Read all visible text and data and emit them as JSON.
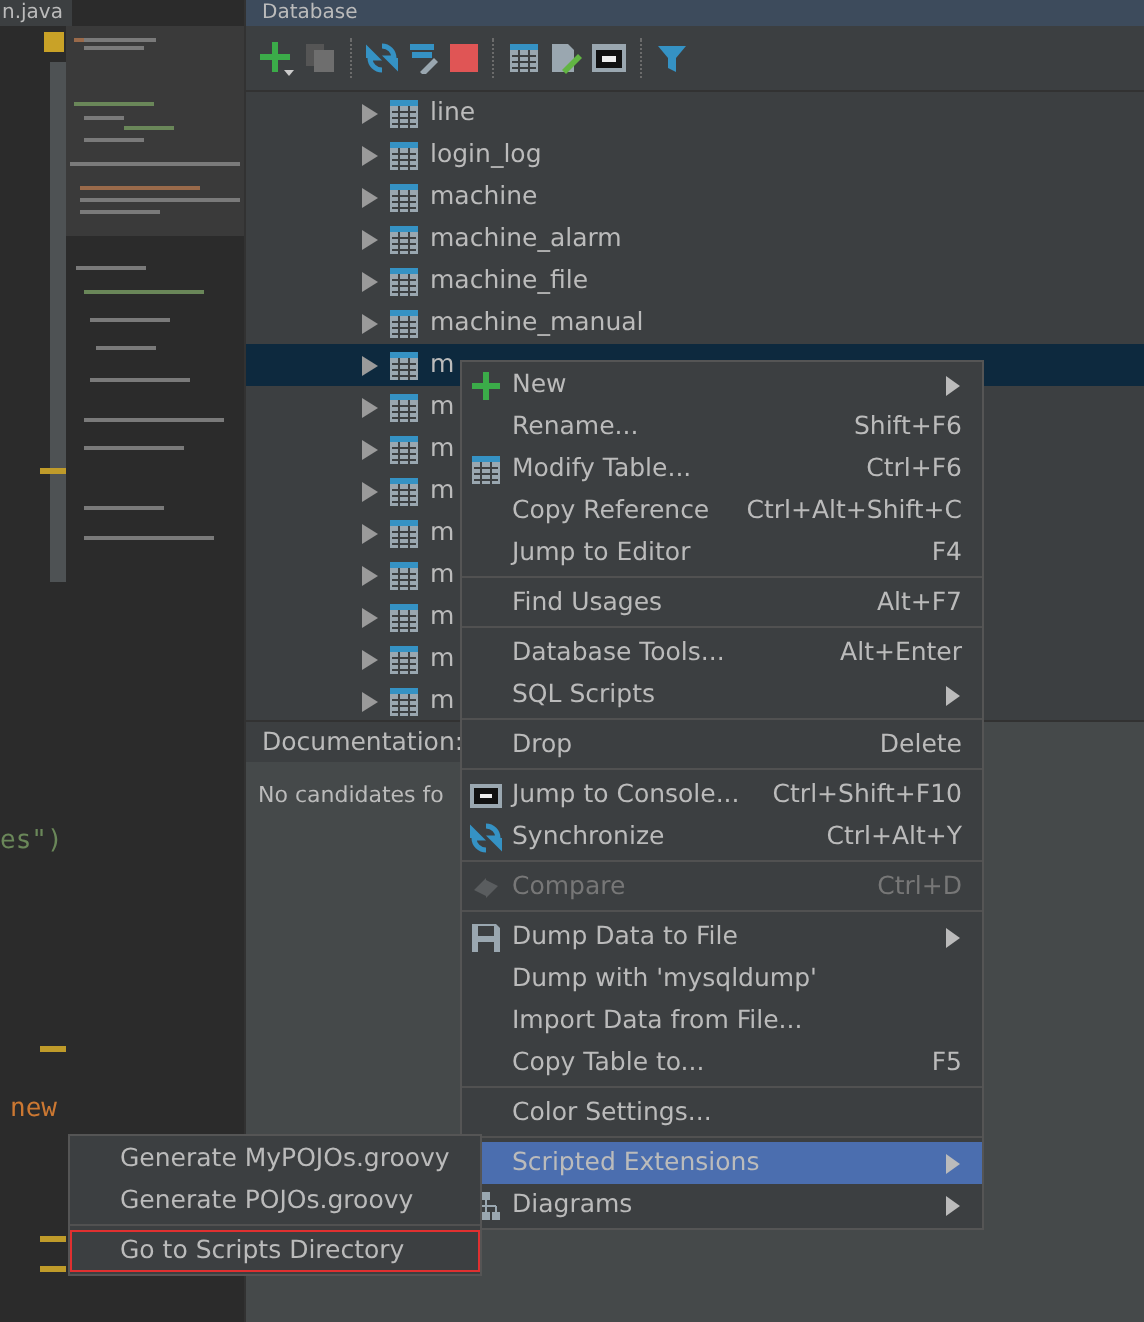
{
  "editor": {
    "tab": "n.java",
    "code": [
      {
        "text": "es\")",
        "kind": "string"
      },
      {
        "text": "new",
        "kind": "keyword"
      }
    ]
  },
  "database": {
    "title": "Database",
    "tree": [
      {
        "label": "line",
        "selected": false
      },
      {
        "label": "login_log",
        "selected": false
      },
      {
        "label": "machine",
        "selected": false
      },
      {
        "label": "machine_alarm",
        "selected": false
      },
      {
        "label": "machine_file",
        "selected": false
      },
      {
        "label": "machine_manual",
        "selected": false
      },
      {
        "label": "m",
        "selected": true
      },
      {
        "label": "m",
        "selected": false
      },
      {
        "label": "m",
        "selected": false
      },
      {
        "label": "m",
        "selected": false
      },
      {
        "label": "m",
        "selected": false
      },
      {
        "label": "m",
        "selected": false
      },
      {
        "label": "m",
        "selected": false
      },
      {
        "label": "m",
        "selected": false
      },
      {
        "label": "m",
        "selected": false
      }
    ],
    "documentation": {
      "label": "Documentation:",
      "text": "No candidates fo"
    }
  },
  "context_menu": {
    "items": [
      {
        "kind": "add",
        "label": "New",
        "submenu": true,
        "disabled": false,
        "selected": false
      },
      {
        "kind": "item",
        "label": "Rename...",
        "shortcut": "Shift+F6",
        "submenu": false,
        "disabled": false,
        "selected": false
      },
      {
        "kind": "table",
        "label": "Modify Table...",
        "shortcut": "Ctrl+F6",
        "submenu": false,
        "disabled": false,
        "selected": false
      },
      {
        "kind": "item",
        "label": "Copy Reference",
        "shortcut": "Ctrl+Alt+Shift+C",
        "submenu": false,
        "disabled": false,
        "selected": false
      },
      {
        "kind": "item",
        "label": "Jump to Editor",
        "shortcut": "F4",
        "submenu": false,
        "disabled": false,
        "selected": false
      },
      {
        "kind": "separator"
      },
      {
        "kind": "item",
        "label": "Find Usages",
        "shortcut": "Alt+F7",
        "submenu": false,
        "disabled": false,
        "selected": false
      },
      {
        "kind": "separator"
      },
      {
        "kind": "item",
        "label": "Database Tools...",
        "shortcut": "Alt+Enter",
        "submenu": false,
        "disabled": false,
        "selected": false
      },
      {
        "kind": "item",
        "label": "SQL Scripts",
        "submenu": true,
        "disabled": false,
        "selected": false
      },
      {
        "kind": "separator"
      },
      {
        "kind": "item",
        "label": "Drop",
        "shortcut": "Delete",
        "submenu": false,
        "disabled": false,
        "selected": false
      },
      {
        "kind": "separator"
      },
      {
        "kind": "console",
        "label": "Jump to Console...",
        "shortcut": "Ctrl+Shift+F10",
        "submenu": false,
        "disabled": false,
        "selected": false
      },
      {
        "kind": "sync",
        "label": "Synchronize",
        "shortcut": "Ctrl+Alt+Y",
        "submenu": false,
        "disabled": false,
        "selected": false
      },
      {
        "kind": "separator"
      },
      {
        "kind": "compare",
        "label": "Compare",
        "shortcut": "Ctrl+D",
        "submenu": false,
        "disabled": true,
        "selected": false
      },
      {
        "kind": "separator"
      },
      {
        "kind": "save",
        "label": "Dump Data to File",
        "submenu": true,
        "disabled": false,
        "selected": false
      },
      {
        "kind": "item",
        "label": "Dump with 'mysqldump'",
        "submenu": false,
        "disabled": false,
        "selected": false
      },
      {
        "kind": "item",
        "label": "Import Data from File...",
        "submenu": false,
        "disabled": false,
        "selected": false
      },
      {
        "kind": "item",
        "label": "Copy Table to...",
        "shortcut": "F5",
        "submenu": false,
        "disabled": false,
        "selected": false
      },
      {
        "kind": "separator"
      },
      {
        "kind": "item",
        "label": "Color Settings...",
        "submenu": false,
        "disabled": false,
        "selected": false
      },
      {
        "kind": "separator"
      },
      {
        "kind": "item",
        "label": "Scripted Extensions",
        "submenu": true,
        "disabled": false,
        "selected": true
      },
      {
        "kind": "diagram",
        "label": "Diagrams",
        "submenu": true,
        "disabled": false,
        "selected": false
      }
    ]
  },
  "submenu": {
    "items": [
      {
        "kind": "item",
        "label": "Generate MyPOJOs.groovy",
        "outlined": false
      },
      {
        "kind": "item",
        "label": "Generate POJOs.groovy",
        "outlined": false
      },
      {
        "kind": "separator"
      },
      {
        "kind": "item",
        "label": "Go to Scripts Directory",
        "outlined": true
      }
    ]
  }
}
